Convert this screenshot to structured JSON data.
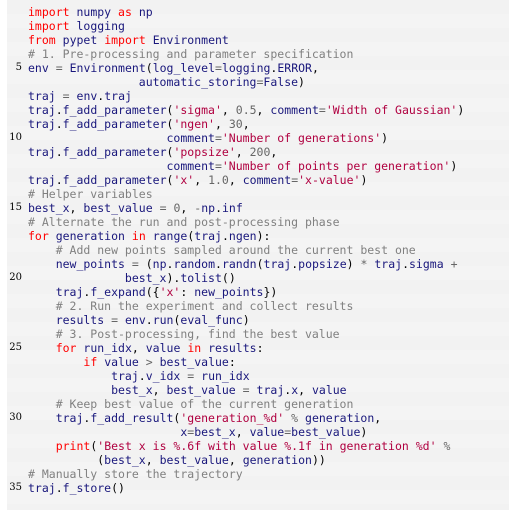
{
  "document": {
    "type": "code-listing",
    "language": "Python",
    "line_number_interval": 5,
    "colors": {
      "background": "#f2f2f2",
      "background_alt": "#f4f4f4",
      "page": "#ffffff",
      "keyword": "#ff0000",
      "name": "#19177c",
      "string": "#b00040",
      "comment": "#808080",
      "operator": "#666666",
      "number": "#666666",
      "punctuation": "#000000",
      "line_number": "#000000"
    }
  },
  "lines": [
    {
      "number": 1,
      "gutter": "",
      "tokens": [
        {
          "t": "import",
          "c": "k"
        },
        {
          "t": " ",
          "c": "p"
        },
        {
          "t": "numpy",
          "c": "n"
        },
        {
          "t": " ",
          "c": "p"
        },
        {
          "t": "as",
          "c": "k"
        },
        {
          "t": " ",
          "c": "p"
        },
        {
          "t": "np",
          "c": "n"
        }
      ]
    },
    {
      "number": 2,
      "gutter": "",
      "tokens": [
        {
          "t": "import",
          "c": "k"
        },
        {
          "t": " ",
          "c": "p"
        },
        {
          "t": "logging",
          "c": "n"
        }
      ]
    },
    {
      "number": 3,
      "gutter": "",
      "tokens": [
        {
          "t": "from",
          "c": "k"
        },
        {
          "t": " ",
          "c": "p"
        },
        {
          "t": "pypet",
          "c": "n"
        },
        {
          "t": " ",
          "c": "p"
        },
        {
          "t": "import",
          "c": "k"
        },
        {
          "t": " ",
          "c": "p"
        },
        {
          "t": "Environment",
          "c": "n"
        }
      ]
    },
    {
      "number": 4,
      "gutter": "",
      "tokens": [
        {
          "t": "# 1. Pre-processing and parameter specification",
          "c": "c"
        }
      ]
    },
    {
      "number": 5,
      "gutter": "5",
      "tokens": [
        {
          "t": "env",
          "c": "n"
        },
        {
          "t": " ",
          "c": "p"
        },
        {
          "t": "=",
          "c": "o"
        },
        {
          "t": " ",
          "c": "p"
        },
        {
          "t": "Environment",
          "c": "n"
        },
        {
          "t": "(",
          "c": "p"
        },
        {
          "t": "log_level",
          "c": "n"
        },
        {
          "t": "=",
          "c": "o"
        },
        {
          "t": "logging",
          "c": "n"
        },
        {
          "t": ".",
          "c": "p"
        },
        {
          "t": "ERROR",
          "c": "n"
        },
        {
          "t": ",",
          "c": "p"
        }
      ]
    },
    {
      "number": 6,
      "gutter": "",
      "tokens": [
        {
          "t": "                automatic_storing",
          "c": "n"
        },
        {
          "t": "=",
          "c": "o"
        },
        {
          "t": "False",
          "c": "n"
        },
        {
          "t": ")",
          "c": "p"
        }
      ]
    },
    {
      "number": 7,
      "gutter": "",
      "tokens": [
        {
          "t": "traj",
          "c": "n"
        },
        {
          "t": " ",
          "c": "p"
        },
        {
          "t": "=",
          "c": "o"
        },
        {
          "t": " ",
          "c": "p"
        },
        {
          "t": "env",
          "c": "n"
        },
        {
          "t": ".",
          "c": "p"
        },
        {
          "t": "traj",
          "c": "n"
        }
      ]
    },
    {
      "number": 8,
      "gutter": "",
      "tokens": [
        {
          "t": "traj",
          "c": "n"
        },
        {
          "t": ".",
          "c": "p"
        },
        {
          "t": "f_add_parameter",
          "c": "n"
        },
        {
          "t": "(",
          "c": "p"
        },
        {
          "t": "'sigma'",
          "c": "s"
        },
        {
          "t": ", ",
          "c": "p"
        },
        {
          "t": "0.5",
          "c": "m"
        },
        {
          "t": ", ",
          "c": "p"
        },
        {
          "t": "comment",
          "c": "n"
        },
        {
          "t": "=",
          "c": "o"
        },
        {
          "t": "'Width of Gaussian'",
          "c": "s"
        },
        {
          "t": ")",
          "c": "p"
        }
      ]
    },
    {
      "number": 9,
      "gutter": "",
      "tokens": [
        {
          "t": "traj",
          "c": "n"
        },
        {
          "t": ".",
          "c": "p"
        },
        {
          "t": "f_add_parameter",
          "c": "n"
        },
        {
          "t": "(",
          "c": "p"
        },
        {
          "t": "'ngen'",
          "c": "s"
        },
        {
          "t": ", ",
          "c": "p"
        },
        {
          "t": "30",
          "c": "m"
        },
        {
          "t": ",",
          "c": "p"
        }
      ]
    },
    {
      "number": 10,
      "gutter": "10",
      "tokens": [
        {
          "t": "                    comment",
          "c": "n"
        },
        {
          "t": "=",
          "c": "o"
        },
        {
          "t": "'Number of generations'",
          "c": "s"
        },
        {
          "t": ")",
          "c": "p"
        }
      ]
    },
    {
      "number": 11,
      "gutter": "",
      "tokens": [
        {
          "t": "traj",
          "c": "n"
        },
        {
          "t": ".",
          "c": "p"
        },
        {
          "t": "f_add_parameter",
          "c": "n"
        },
        {
          "t": "(",
          "c": "p"
        },
        {
          "t": "'popsize'",
          "c": "s"
        },
        {
          "t": ", ",
          "c": "p"
        },
        {
          "t": "200",
          "c": "m"
        },
        {
          "t": ",",
          "c": "p"
        }
      ]
    },
    {
      "number": 12,
      "gutter": "",
      "tokens": [
        {
          "t": "                    comment",
          "c": "n"
        },
        {
          "t": "=",
          "c": "o"
        },
        {
          "t": "'Number of points per generation'",
          "c": "s"
        },
        {
          "t": ")",
          "c": "p"
        }
      ]
    },
    {
      "number": 13,
      "gutter": "",
      "tokens": [
        {
          "t": "traj",
          "c": "n"
        },
        {
          "t": ".",
          "c": "p"
        },
        {
          "t": "f_add_parameter",
          "c": "n"
        },
        {
          "t": "(",
          "c": "p"
        },
        {
          "t": "'x'",
          "c": "s"
        },
        {
          "t": ", ",
          "c": "p"
        },
        {
          "t": "1.0",
          "c": "m"
        },
        {
          "t": ", ",
          "c": "p"
        },
        {
          "t": "comment",
          "c": "n"
        },
        {
          "t": "=",
          "c": "o"
        },
        {
          "t": "'x-value'",
          "c": "s"
        },
        {
          "t": ")",
          "c": "p"
        }
      ]
    },
    {
      "number": 14,
      "gutter": "",
      "tokens": [
        {
          "t": "# Helper variables",
          "c": "c"
        }
      ]
    },
    {
      "number": 15,
      "gutter": "15",
      "tokens": [
        {
          "t": "best_x",
          "c": "n"
        },
        {
          "t": ", ",
          "c": "p"
        },
        {
          "t": "best_value",
          "c": "n"
        },
        {
          "t": " ",
          "c": "p"
        },
        {
          "t": "=",
          "c": "o"
        },
        {
          "t": " ",
          "c": "p"
        },
        {
          "t": "0",
          "c": "m"
        },
        {
          "t": ", ",
          "c": "p"
        },
        {
          "t": "-",
          "c": "o"
        },
        {
          "t": "np",
          "c": "n"
        },
        {
          "t": ".",
          "c": "p"
        },
        {
          "t": "inf",
          "c": "n"
        }
      ]
    },
    {
      "number": 16,
      "gutter": "",
      "tokens": [
        {
          "t": "# Alternate the run and post-processing phase",
          "c": "c"
        }
      ]
    },
    {
      "number": 17,
      "gutter": "",
      "tokens": [
        {
          "t": "for",
          "c": "k"
        },
        {
          "t": " ",
          "c": "p"
        },
        {
          "t": "generation",
          "c": "n"
        },
        {
          "t": " ",
          "c": "p"
        },
        {
          "t": "in",
          "c": "k"
        },
        {
          "t": " ",
          "c": "p"
        },
        {
          "t": "range",
          "c": "n"
        },
        {
          "t": "(",
          "c": "p"
        },
        {
          "t": "traj",
          "c": "n"
        },
        {
          "t": ".",
          "c": "p"
        },
        {
          "t": "ngen",
          "c": "n"
        },
        {
          "t": "):",
          "c": "p"
        }
      ]
    },
    {
      "number": 18,
      "gutter": "",
      "tokens": [
        {
          "t": "    # Add new points sampled around the current best one",
          "c": "c"
        }
      ]
    },
    {
      "number": 19,
      "gutter": "",
      "tokens": [
        {
          "t": "    new_points",
          "c": "n"
        },
        {
          "t": " ",
          "c": "p"
        },
        {
          "t": "=",
          "c": "o"
        },
        {
          "t": " (",
          "c": "p"
        },
        {
          "t": "np",
          "c": "n"
        },
        {
          "t": ".",
          "c": "p"
        },
        {
          "t": "random",
          "c": "n"
        },
        {
          "t": ".",
          "c": "p"
        },
        {
          "t": "randn",
          "c": "n"
        },
        {
          "t": "(",
          "c": "p"
        },
        {
          "t": "traj",
          "c": "n"
        },
        {
          "t": ".",
          "c": "p"
        },
        {
          "t": "popsize",
          "c": "n"
        },
        {
          "t": ") ",
          "c": "p"
        },
        {
          "t": "*",
          "c": "o"
        },
        {
          "t": " ",
          "c": "p"
        },
        {
          "t": "traj",
          "c": "n"
        },
        {
          "t": ".",
          "c": "p"
        },
        {
          "t": "sigma",
          "c": "n"
        },
        {
          "t": " ",
          "c": "p"
        },
        {
          "t": "+",
          "c": "o"
        }
      ]
    },
    {
      "number": 20,
      "gutter": "20",
      "tokens": [
        {
          "t": "              best_x",
          "c": "n"
        },
        {
          "t": ").",
          "c": "p"
        },
        {
          "t": "tolist",
          "c": "n"
        },
        {
          "t": "()",
          "c": "p"
        }
      ]
    },
    {
      "number": 21,
      "gutter": "",
      "tokens": [
        {
          "t": "    traj",
          "c": "n"
        },
        {
          "t": ".",
          "c": "p"
        },
        {
          "t": "f_expand",
          "c": "n"
        },
        {
          "t": "({",
          "c": "p"
        },
        {
          "t": "'x'",
          "c": "s"
        },
        {
          "t": ": ",
          "c": "p"
        },
        {
          "t": "new_points",
          "c": "n"
        },
        {
          "t": "})",
          "c": "p"
        }
      ]
    },
    {
      "number": 22,
      "gutter": "",
      "tokens": [
        {
          "t": "    # 2. Run the experiment and collect results",
          "c": "c"
        }
      ]
    },
    {
      "number": 23,
      "gutter": "",
      "tokens": [
        {
          "t": "    results",
          "c": "n"
        },
        {
          "t": " ",
          "c": "p"
        },
        {
          "t": "=",
          "c": "o"
        },
        {
          "t": " ",
          "c": "p"
        },
        {
          "t": "env",
          "c": "n"
        },
        {
          "t": ".",
          "c": "p"
        },
        {
          "t": "run",
          "c": "n"
        },
        {
          "t": "(",
          "c": "p"
        },
        {
          "t": "eval_func",
          "c": "n"
        },
        {
          "t": ")",
          "c": "p"
        }
      ]
    },
    {
      "number": 24,
      "gutter": "",
      "tokens": [
        {
          "t": "    # 3. Post-processing, find the best value",
          "c": "c"
        }
      ]
    },
    {
      "number": 25,
      "gutter": "25",
      "tokens": [
        {
          "t": "    ",
          "c": "p"
        },
        {
          "t": "for",
          "c": "k"
        },
        {
          "t": " ",
          "c": "p"
        },
        {
          "t": "run_idx",
          "c": "n"
        },
        {
          "t": ", ",
          "c": "p"
        },
        {
          "t": "value",
          "c": "n"
        },
        {
          "t": " ",
          "c": "p"
        },
        {
          "t": "in",
          "c": "k"
        },
        {
          "t": " ",
          "c": "p"
        },
        {
          "t": "results",
          "c": "n"
        },
        {
          "t": ":",
          "c": "p"
        }
      ]
    },
    {
      "number": 26,
      "gutter": "",
      "tokens": [
        {
          "t": "        ",
          "c": "p"
        },
        {
          "t": "if",
          "c": "k"
        },
        {
          "t": " ",
          "c": "p"
        },
        {
          "t": "value",
          "c": "n"
        },
        {
          "t": " ",
          "c": "p"
        },
        {
          "t": ">",
          "c": "o"
        },
        {
          "t": " ",
          "c": "p"
        },
        {
          "t": "best_value",
          "c": "n"
        },
        {
          "t": ":",
          "c": "p"
        }
      ]
    },
    {
      "number": 27,
      "gutter": "",
      "tokens": [
        {
          "t": "            traj",
          "c": "n"
        },
        {
          "t": ".",
          "c": "p"
        },
        {
          "t": "v_idx",
          "c": "n"
        },
        {
          "t": " ",
          "c": "p"
        },
        {
          "t": "=",
          "c": "o"
        },
        {
          "t": " ",
          "c": "p"
        },
        {
          "t": "run_idx",
          "c": "n"
        }
      ]
    },
    {
      "number": 28,
      "gutter": "",
      "tokens": [
        {
          "t": "            best_x",
          "c": "n"
        },
        {
          "t": ", ",
          "c": "p"
        },
        {
          "t": "best_value",
          "c": "n"
        },
        {
          "t": " ",
          "c": "p"
        },
        {
          "t": "=",
          "c": "o"
        },
        {
          "t": " ",
          "c": "p"
        },
        {
          "t": "traj",
          "c": "n"
        },
        {
          "t": ".",
          "c": "p"
        },
        {
          "t": "x",
          "c": "n"
        },
        {
          "t": ", ",
          "c": "p"
        },
        {
          "t": "value",
          "c": "n"
        }
      ]
    },
    {
      "number": 29,
      "gutter": "",
      "tokens": [
        {
          "t": "    # Keep best value of the current generation",
          "c": "c"
        }
      ]
    },
    {
      "number": 30,
      "gutter": "30",
      "tokens": [
        {
          "t": "    traj",
          "c": "n"
        },
        {
          "t": ".",
          "c": "p"
        },
        {
          "t": "f_add_result",
          "c": "n"
        },
        {
          "t": "(",
          "c": "p"
        },
        {
          "t": "'generation_%d'",
          "c": "s"
        },
        {
          "t": " ",
          "c": "p"
        },
        {
          "t": "%",
          "c": "o"
        },
        {
          "t": " ",
          "c": "p"
        },
        {
          "t": "generation",
          "c": "n"
        },
        {
          "t": ",",
          "c": "p"
        }
      ]
    },
    {
      "number": 31,
      "gutter": "",
      "tokens": [
        {
          "t": "                      x",
          "c": "n"
        },
        {
          "t": "=",
          "c": "o"
        },
        {
          "t": "best_x",
          "c": "n"
        },
        {
          "t": ", ",
          "c": "p"
        },
        {
          "t": "value",
          "c": "n"
        },
        {
          "t": "=",
          "c": "o"
        },
        {
          "t": "best_value",
          "c": "n"
        },
        {
          "t": ")",
          "c": "p"
        }
      ]
    },
    {
      "number": 32,
      "gutter": "",
      "tokens": [
        {
          "t": "    ",
          "c": "p"
        },
        {
          "t": "print",
          "c": "k"
        },
        {
          "t": "(",
          "c": "p"
        },
        {
          "t": "'Best x is %.6f with value %.1f in generation %d'",
          "c": "s"
        },
        {
          "t": " ",
          "c": "p"
        },
        {
          "t": "%",
          "c": "o"
        }
      ]
    },
    {
      "number": 33,
      "gutter": "",
      "tokens": [
        {
          "t": "          (",
          "c": "p"
        },
        {
          "t": "best_x",
          "c": "n"
        },
        {
          "t": ", ",
          "c": "p"
        },
        {
          "t": "best_value",
          "c": "n"
        },
        {
          "t": ", ",
          "c": "p"
        },
        {
          "t": "generation",
          "c": "n"
        },
        {
          "t": "))",
          "c": "p"
        }
      ]
    },
    {
      "number": 34,
      "gutter": "",
      "tokens": [
        {
          "t": "# Manually store the trajectory",
          "c": "c"
        }
      ]
    },
    {
      "number": 35,
      "gutter": "35",
      "tokens": [
        {
          "t": "traj",
          "c": "n"
        },
        {
          "t": ".",
          "c": "p"
        },
        {
          "t": "f_store",
          "c": "n"
        },
        {
          "t": "()",
          "c": "p"
        }
      ]
    }
  ]
}
